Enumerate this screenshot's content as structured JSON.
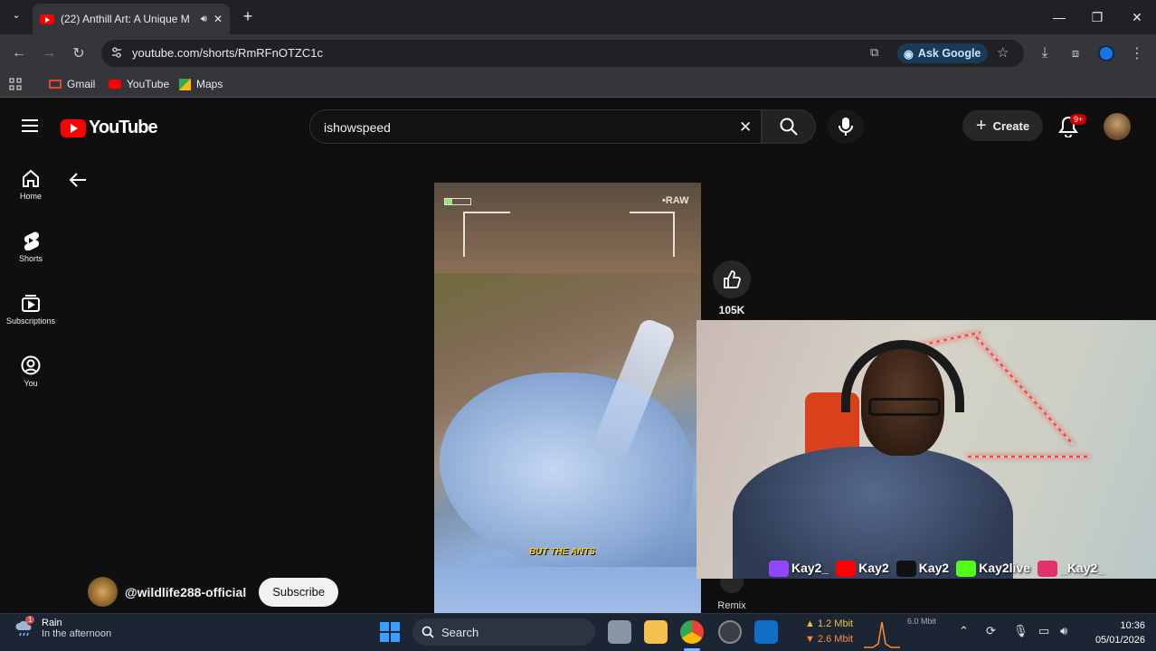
{
  "browser": {
    "tab_title": "(22) Anthill Art: A Unique M",
    "url": "youtube.com/shorts/RmRFnOTZC1c",
    "ask_google": "Ask Google",
    "bookmarks": [
      {
        "label": "Gmail",
        "icon": "gmail-icon"
      },
      {
        "label": "YouTube",
        "icon": "youtube-icon"
      },
      {
        "label": "Maps",
        "icon": "maps-icon"
      }
    ]
  },
  "youtube": {
    "logo_text": "YouTube",
    "search_value": "ishowspeed",
    "create_label": "Create",
    "notification_badge": "9+",
    "nav": [
      {
        "label": "Home",
        "icon": "home-icon"
      },
      {
        "label": "Shorts",
        "icon": "shorts-icon"
      },
      {
        "label": "Subscriptions",
        "icon": "subscriptions-icon"
      },
      {
        "label": "You",
        "icon": "you-icon"
      }
    ],
    "video": {
      "overlay_tag": "•RAW",
      "caption": "BUT THE ANTS"
    },
    "like_count": "105K",
    "remix_label": "Remix",
    "channel_name": "@wildlife288-official",
    "subscribe_label": "Subscribe"
  },
  "stream_overlay": {
    "handles": [
      {
        "label": "Kay2_",
        "color": "#9146ff"
      },
      {
        "label": "Kay2",
        "color": "#ff0000"
      },
      {
        "label": "Kay2",
        "color": "#111111"
      },
      {
        "label": "Kay2live",
        "color": "#53fc18"
      },
      {
        "label": "_Kay2_",
        "color": "#e1306c"
      }
    ]
  },
  "taskbar": {
    "weather_title": "Rain",
    "weather_sub": "In the afternoon",
    "weather_badge": "1",
    "search_label": "Search",
    "net_up": "▲ 1.2 Mbit",
    "net_down": "▼ 2.6 Mbit",
    "net_scale": "6.0 Mbit",
    "time": "10:36",
    "date": "05/01/2026"
  }
}
